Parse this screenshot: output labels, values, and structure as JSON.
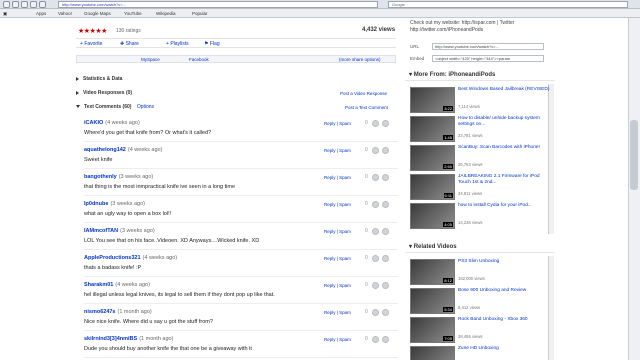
{
  "browser": {
    "url": "http://www.youtube.com/watch?v=...",
    "search": "Google",
    "bookmarks": [
      "Apps",
      "Vahoo!",
      "Google Maps",
      "YouTube",
      "Wikipedia",
      "Popular"
    ]
  },
  "video": {
    "stars": "★★★★★",
    "ratings": "130 ratings",
    "views": "4,432 views",
    "actions": [
      "Favorite",
      "Share",
      "Playlists",
      "Flag"
    ],
    "tabs": [
      "MySpace",
      "Facebook",
      "(more share options)"
    ]
  },
  "sections": {
    "stats": "Statistics & Data",
    "responses": "Video Responses (0)",
    "responses_link": "Post a Video Response",
    "comments": "Text Comments (60)",
    "comments_options": "Options",
    "comments_link": "Post a Text Comment"
  },
  "comments": [
    {
      "user": "iCAKIO",
      "time": "(4 weeks ago)",
      "text": "Where'd you get that knife from? Or what's it called?"
    },
    {
      "user": "aquathelong142",
      "time": "(4 weeks ago)",
      "text": "Sweet knife"
    },
    {
      "user": "bangothenly",
      "time": "(3 weeks ago)",
      "text": "that thing is the most inmpractical knife ive seen in a long time"
    },
    {
      "user": "Ip0dnube",
      "time": "(3 weeks ago)",
      "text": "what an ugly way to open a box lol!!"
    },
    {
      "user": "IAMmcofTAN",
      "time": "(3 weeks ago)",
      "text": "LOL You see that on his face..Videoen. XD Anyways....Wicked knife. XD"
    },
    {
      "user": "AppleProductions321",
      "time": "(4 weeks ago)",
      "text": "thats a badass knife! :P"
    },
    {
      "user": "Sharakm01",
      "time": "(4 weeks ago)",
      "text": "hel illegal unless legal knives, its legal to sell them if they dont pop up like that."
    },
    {
      "user": "nismo6247s",
      "time": "(1 month ago)",
      "text": "Nice nice knife. Where did u say u got the stuff from?"
    },
    {
      "user": "skilrnind3[3]4nmiBS",
      "time": "(1 month ago)",
      "text": "Dude you should buy another knife the that one be a giveaway with it"
    }
  ],
  "comment_actions": {
    "reply": "Reply | Spam"
  },
  "share": {
    "text1": "Check out my website: http://ispar.com | Twitter",
    "text2": "http://twitter.com/iPhoneandPods",
    "url_label": "URL",
    "url_value": "http://www.youtube.com/watch?v=...",
    "embed_label": "Embed",
    "embed_value": "<object width=\"425\" height=\"344\"><param"
  },
  "more_from": {
    "title": "More From: iPhoneandiPods",
    "videos": [
      {
        "title": "Best Windows Based Jailbreak (REVISED)",
        "views": "7,114 views",
        "dur": "3:22"
      },
      {
        "title": "How to disable/ unhide backup system settings on...",
        "views": "23,781 views",
        "dur": "1:45"
      },
      {
        "title": "ScanBuy: Scan Barcodes with iPhone!",
        "views": "26,763 views",
        "dur": "2:50"
      },
      {
        "title": "JAILBREAKING 2.1 Firmware for iPod Touch 1st & 2nd...",
        "views": "34,811 views",
        "dur": "6:11"
      },
      {
        "title": "how to install Cydia for your iPod...",
        "views": "14,236 views",
        "dur": "4:05"
      }
    ]
  },
  "related": {
    "title": "Related Videos",
    "videos": [
      {
        "title": "PS3 Slim Unboxing",
        "views": "162,000 views",
        "dur": "8:12"
      },
      {
        "title": "Bose 900 Unboxing and Review",
        "views": "9,412 views",
        "dur": "5:34"
      },
      {
        "title": "Rock Band Unboxing - Xbox 360",
        "views": "28,455 views",
        "dur": "7:05"
      },
      {
        "title": "Zune HD Unboxing",
        "views": "OrbitalKicks",
        "dur": "6:22"
      }
    ]
  },
  "colors": {
    "link": "#0033cc",
    "star": "#cc0000",
    "accent": "#333333"
  }
}
